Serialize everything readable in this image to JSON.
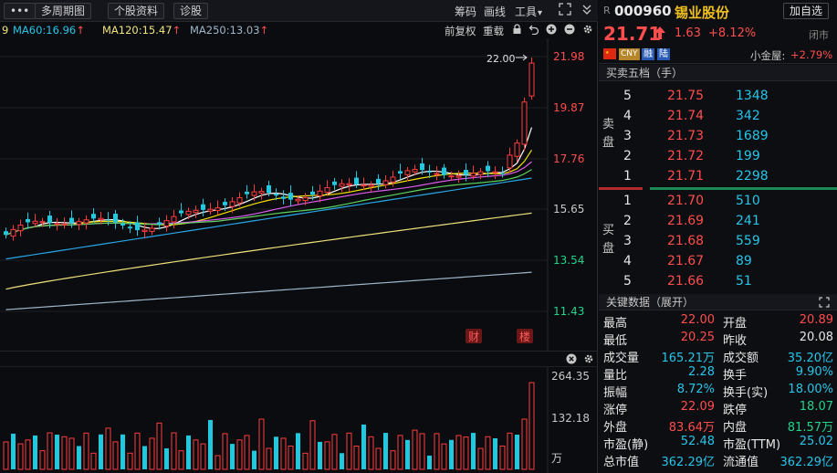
{
  "toolbar": {
    "more_label": "•••",
    "multi_period": "多周期图",
    "stock_profile": "个股资料",
    "diagnose": "诊股",
    "chips": "筹码",
    "draw": "画线",
    "tools": "工具",
    "tools_caret": "▾"
  },
  "ma": {
    "partial": "9",
    "ma60": "MA60:16.96",
    "ma120": "MA120:15.47",
    "ma250": "MA250:13.03",
    "up_arrow": "↑",
    "ma60_color": "#27c5e8",
    "ma120_color": "#f0e27a",
    "ma250_color": "#9fb6c8",
    "fuquan": "前复权",
    "overlay": "重载"
  },
  "kchart": {
    "price_labels": [
      "21.98",
      "19.87",
      "17.76",
      "15.65",
      "13.54",
      "11.43"
    ],
    "high_marker": "22.00",
    "badge_cai": "财",
    "badge_lou": "楼"
  },
  "volume": {
    "labels": [
      "264.35",
      "132.18",
      "万"
    ]
  },
  "stock": {
    "market": "R",
    "code": "000960",
    "name": "锡业股份",
    "add_watch": "加自选",
    "price": "21.71",
    "change": "1.63",
    "change_pct": "+8.12%",
    "status": "闭市",
    "tag_cny": "CNY",
    "tag_rong": "融",
    "tag_lu": "陆",
    "xiaojinwu_label": "小金屋:",
    "xiaojinwu_value": "+2.79%",
    "up_color": "#ff4d4d",
    "down_color": "#22d48c"
  },
  "orderbook": {
    "title": "买卖五档（手）",
    "sell_label": "卖盘",
    "buy_label": "买盘",
    "sell": [
      {
        "level": "5",
        "price": "21.75",
        "vol": "1348"
      },
      {
        "level": "4",
        "price": "21.74",
        "vol": "342"
      },
      {
        "level": "3",
        "price": "21.73",
        "vol": "1689"
      },
      {
        "level": "2",
        "price": "21.72",
        "vol": "199"
      },
      {
        "level": "1",
        "price": "21.71",
        "vol": "2298"
      }
    ],
    "buy": [
      {
        "level": "1",
        "price": "21.70",
        "vol": "510"
      },
      {
        "level": "2",
        "price": "21.69",
        "vol": "241"
      },
      {
        "level": "3",
        "price": "21.68",
        "vol": "559"
      },
      {
        "level": "4",
        "price": "21.67",
        "vol": "89"
      },
      {
        "level": "5",
        "price": "21.66",
        "vol": "51"
      }
    ]
  },
  "keydata": {
    "title": "关键数据（展开）",
    "rows": [
      {
        "l1": "最高",
        "v1": "22.00",
        "c1": "red",
        "l2": "开盘",
        "v2": "20.89",
        "c2": "red"
      },
      {
        "l1": "最低",
        "v1": "20.25",
        "c1": "red",
        "l2": "昨收",
        "v2": "20.08",
        "c2": "white"
      },
      {
        "l1": "成交量",
        "v1": "165.21万",
        "c1": "cyan",
        "l2": "成交额",
        "v2": "35.20亿",
        "c2": "cyan"
      },
      {
        "l1": "量比",
        "v1": "2.28",
        "c1": "cyan",
        "l2": "换手",
        "v2": "9.90%",
        "c2": "cyan"
      },
      {
        "l1": "振幅",
        "v1": "8.72%",
        "c1": "cyan",
        "l2": "换手(实)",
        "v2": "18.00%",
        "c2": "cyan"
      },
      {
        "l1": "涨停",
        "v1": "22.09",
        "c1": "red",
        "l2": "跌停",
        "v2": "18.07",
        "c2": "green"
      },
      {
        "l1": "外盘",
        "v1": "83.64万",
        "c1": "red",
        "l2": "内盘",
        "v2": "81.57万",
        "c2": "green"
      },
      {
        "l1": "市盈(静)",
        "v1": "52.48",
        "c1": "cyan",
        "l2": "市盈(TTM)",
        "v2": "25.02",
        "c2": "cyan"
      },
      {
        "l1": "总市值",
        "v1": "362.29亿",
        "c1": "cyan",
        "l2": "流通值",
        "v2": "362.29亿",
        "c2": "cyan"
      }
    ]
  },
  "colors": {
    "up": "#ff3b3b",
    "down": "#21c8de",
    "ma5": "#ffffff",
    "ma10": "#f5e300",
    "ma20": "#e05cf0",
    "ma30": "#5cd65c",
    "ma60": "#27a8e8",
    "ma120": "#f0e27a",
    "ma250": "#9fb6c8"
  }
}
